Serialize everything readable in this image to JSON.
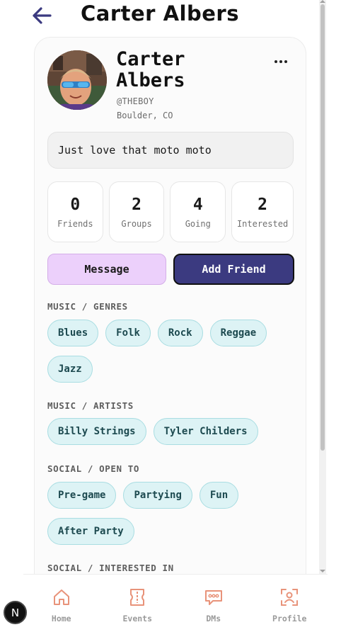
{
  "header": {
    "title": "Carter Albers"
  },
  "profile": {
    "name": "Carter Albers",
    "handle": "@THEBOY",
    "location": "Boulder, CO",
    "bio": "Just love that moto moto"
  },
  "stats": [
    {
      "value": "0",
      "label": "Friends"
    },
    {
      "value": "2",
      "label": "Groups"
    },
    {
      "value": "4",
      "label": "Going"
    },
    {
      "value": "2",
      "label": "Interested"
    }
  ],
  "actions": {
    "message": "Message",
    "add_friend": "Add Friend"
  },
  "sections": {
    "genres": {
      "label": "MUSIC / GENRES",
      "chips": [
        "Blues",
        "Folk",
        "Rock",
        "Reggae",
        "Jazz"
      ]
    },
    "artists": {
      "label": "MUSIC / ARTISTS",
      "chips": [
        "Billy Strings",
        "Tyler Childers"
      ]
    },
    "open_to": {
      "label": "SOCIAL / OPEN TO",
      "chips": [
        "Pre-game",
        "Partying",
        "Fun",
        "After Party"
      ]
    },
    "interested_in": {
      "label": "SOCIAL / INTERESTED IN"
    }
  },
  "nav": {
    "home": "Home",
    "events": "Events",
    "dms": "DMs",
    "profile": "Profile"
  },
  "badge": {
    "letter": "N"
  },
  "colors": {
    "accent": "#3b3a80",
    "message_bg": "#ecd0fb",
    "chip_bg": "#ddf3f5",
    "nav_icon": "#e8937a"
  }
}
